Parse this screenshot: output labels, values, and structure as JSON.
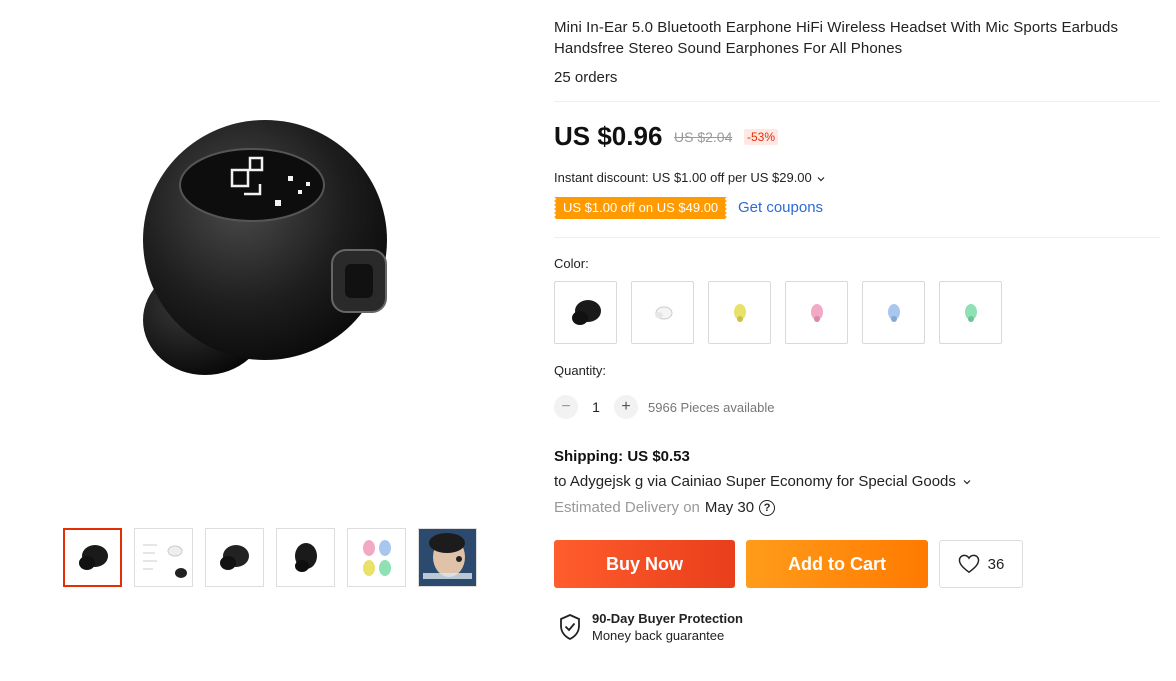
{
  "product": {
    "title": "Mini In-Ear 5.0 Bluetooth Earphone HiFi Wireless Headset With Mic Sports Earbuds Handsfree Stereo Sound Earphones For All Phones",
    "orders": "25 orders"
  },
  "price": {
    "current": "US $0.96",
    "original": "US $2.04",
    "discount": "-53%"
  },
  "promo": {
    "instant_discount": "Instant discount: US $1.00 off per US $29.00",
    "coupon": "US $1.00 off on US $49.00",
    "get_coupons": "Get coupons"
  },
  "color": {
    "label": "Color:",
    "options": [
      "black",
      "white",
      "yellow",
      "pink",
      "blue",
      "green"
    ],
    "swatch_colors": [
      "#1a1a1a",
      "#eeeeee",
      "#e8e26a",
      "#f2a9c4",
      "#a9c6ee",
      "#8fe0b4"
    ]
  },
  "quantity": {
    "label": "Quantity:",
    "minus": "−",
    "plus": "+",
    "value": "1",
    "available": "5966 Pieces available"
  },
  "shipping": {
    "cost": "Shipping: US $0.53",
    "route": "to Adygejsk g via Cainiao Super Economy for Special Goods",
    "delivery_label": "Estimated Delivery on",
    "delivery_date": "May 30",
    "help": "?"
  },
  "actions": {
    "buy_now": "Buy Now",
    "add_to_cart": "Add to Cart",
    "wishlist_count": "36"
  },
  "protection": {
    "title": "90-Day Buyer Protection",
    "subtitle": "Money back guarantee"
  },
  "icons": {
    "dropdown": "chevron-down-icon",
    "wishlist": "heart-icon",
    "protection": "shield-check-icon",
    "help": "question-circle-icon"
  },
  "colors": {
    "accent_red": "#e62e04",
    "buy_gradient": "#ff5d2d",
    "cart_gradient": "#ff8c0a",
    "coupon_bg": "#ff9a00",
    "link_blue": "#2e6ad6"
  }
}
